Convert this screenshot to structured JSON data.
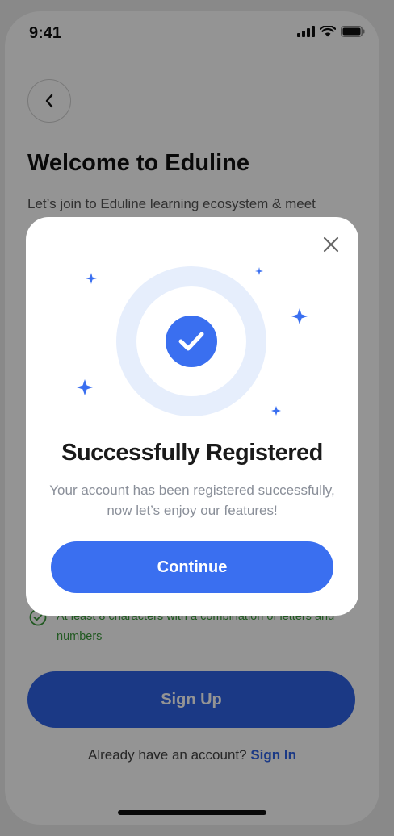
{
  "status_bar": {
    "time": "9:41"
  },
  "screen": {
    "title": "Welcome to Eduline",
    "subtitle": "Let’s join to Eduline learning ecosystem & meet",
    "password_hint": "At least 8 characters with a combination of letters and numbers",
    "signup_label": "Sign Up",
    "signin_prompt": "Already have an account?",
    "signin_link": "Sign In"
  },
  "modal": {
    "title": "Successfully Registered",
    "message": "Your account has been registered successfully, now let’s enjoy our features!",
    "continue_label": "Continue"
  },
  "icons": {
    "back": "chevron-left-icon",
    "close": "close-icon",
    "success": "check-circle-icon",
    "hint": "check-circle-outline-icon",
    "signal": "signal-icon",
    "wifi": "wifi-icon",
    "battery": "battery-icon"
  },
  "colors": {
    "primary": "#3a6ff0",
    "success_green": "#3a9a3a",
    "illustration_ring": "#e6eefc"
  }
}
